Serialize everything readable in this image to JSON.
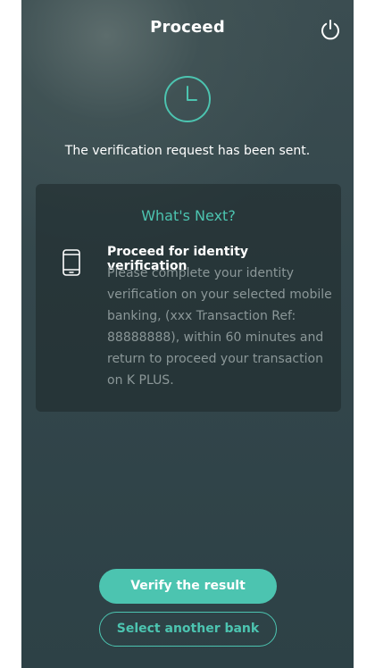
{
  "header": {
    "title": "Proceed",
    "power_icon": "power-icon"
  },
  "status": {
    "icon": "clock-icon",
    "message": "The verification request has been sent."
  },
  "next_card": {
    "heading": "What's Next?",
    "step": {
      "icon": "mobile-phone-icon",
      "title": "Proceed for identity verification",
      "description": "Please complete your identity verification on your selected mobile banking, (xxx Transaction Ref: 88888888), within 60 minutes and return to proceed your transaction on K PLUS."
    }
  },
  "actions": {
    "verify_label": "Verify the result",
    "select_bank_label": "Select another bank"
  },
  "colors": {
    "accent": "#4cc4b0",
    "background": "#34474c",
    "muted_text": "#8b9798"
  }
}
